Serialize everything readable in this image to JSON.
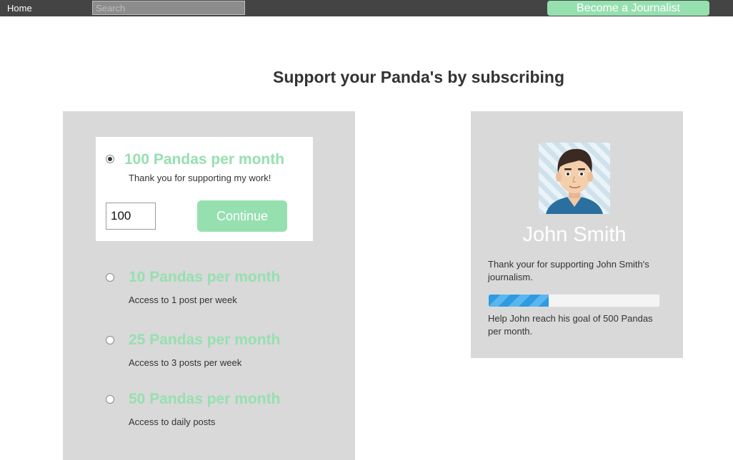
{
  "nav": {
    "home_label": "Home",
    "search_placeholder": "Search",
    "journalist_button": "Become a Journalist"
  },
  "page": {
    "title": "Support your Panda's by subscribing"
  },
  "plans": {
    "selected": {
      "title": "100 Pandas per month",
      "description": "Thank you for supporting my work!",
      "amount_value": "100",
      "continue_label": "Continue"
    },
    "options": [
      {
        "title": "10 Pandas per month",
        "description": "Access to 1 post per week"
      },
      {
        "title": "25 Pandas per month",
        "description": "Access to 3 posts per week"
      },
      {
        "title": "50 Pandas per month",
        "description": "Access to  daily posts"
      }
    ]
  },
  "profile": {
    "name": "John Smith",
    "thanks_text": "Thank your for supporting John Smith's journalism.",
    "goal_text": "Help John reach his goal of 500 Pandas per month.",
    "progress_fraction": 0.35,
    "avatar_icon": "user-avatar-icon"
  },
  "colors": {
    "accent_green": "#96e0b0",
    "topbar": "#444444",
    "panel_gray": "#d9d9d9",
    "progress_blue": "#2f9be0"
  }
}
